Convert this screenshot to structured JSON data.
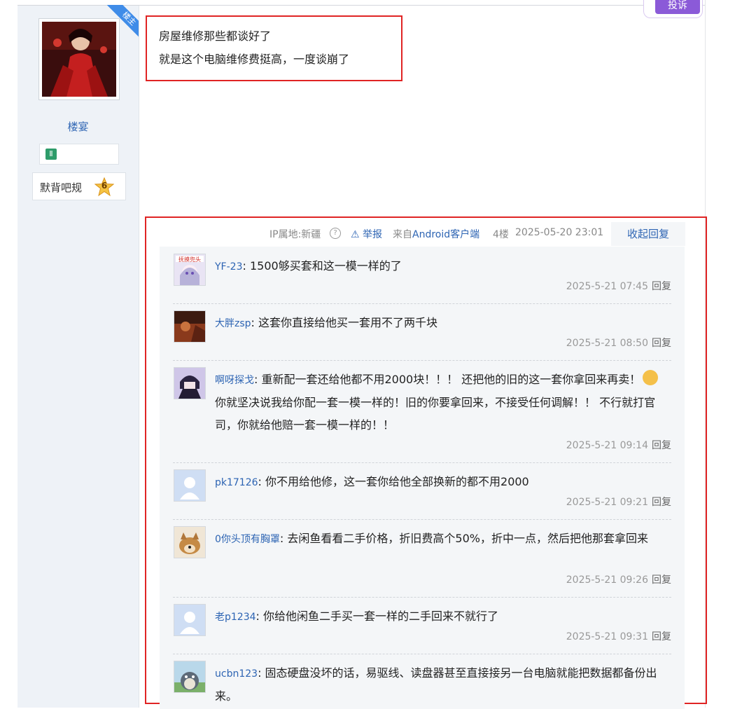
{
  "colors": {
    "highlight_border": "#e02424",
    "link": "#2d64b3",
    "left_column_bg": "#eef2f7"
  },
  "author": {
    "username": "楼宴",
    "corner_tag": "楼主",
    "gem_icon": "gemini-icon",
    "level_name": "默背吧规",
    "level_number": "6"
  },
  "header_button": {
    "label": "投诉"
  },
  "post": {
    "lines": [
      "房屋维修那些都谈好了",
      "就是这个电脑维修费挺高，一度谈崩了"
    ]
  },
  "meta": {
    "ip": "IP属地:新疆",
    "help_icon": "question-icon",
    "report": "举报",
    "source": "来自Android客户端",
    "floor": "4楼",
    "datetime": "2025-05-20 23:01",
    "collapse": "收起回复"
  },
  "comments": [
    {
      "user": "YF-23",
      "text": "1500够买套和这一模一样的了",
      "time": "2025-5-21 07:45",
      "reply": "回复",
      "avatar": "anime-avatar",
      "avatar_caption": "抚摸兜头"
    },
    {
      "user": "大胖zsp",
      "text": "这套你直接给他买一套用不了两千块",
      "time": "2025-5-21 08:50",
      "reply": "回复",
      "avatar": "photo-avatar"
    },
    {
      "user": "啊呀探戈",
      "text_before_emoji": "重新配一套还给他都不用2000块！！！ 还把他的旧的这一套你拿回来再卖！",
      "emoji": "smile-emoji",
      "text_after_emoji": "你就坚决说我给你配一套一模一样的！旧的你要拿回来，不接受任何调解！！ 不行就打官司，你就给他赔一套一模一样的！！",
      "time": "2025-5-21 09:14",
      "reply": "回复",
      "avatar": "anime-avatar"
    },
    {
      "user": "pk17126",
      "text": "你不用给他修，这一套你给他全部换新的都不用2000",
      "time": "2025-5-21 09:21",
      "reply": "回复",
      "avatar": "default-avatar"
    },
    {
      "user": "0你头顶有胸罩",
      "text": "去闲鱼看看二手价格，折旧费高个50%，折中一点，然后把他那套拿回来",
      "time": "2025-5-21 09:26",
      "reply": "回复",
      "avatar": "dog-avatar"
    },
    {
      "user": "老p1234",
      "text": "你给他闲鱼二手买一套一样的二手回来不就行了",
      "time": "2025-5-21 09:31",
      "reply": "回复",
      "avatar": "default-avatar"
    },
    {
      "user": "ucbn123",
      "text": "固态硬盘没坏的话，易驱线、读盘器甚至直接接另一台电脑就能把数据都备份出来。",
      "avatar": "totoro-avatar"
    }
  ]
}
